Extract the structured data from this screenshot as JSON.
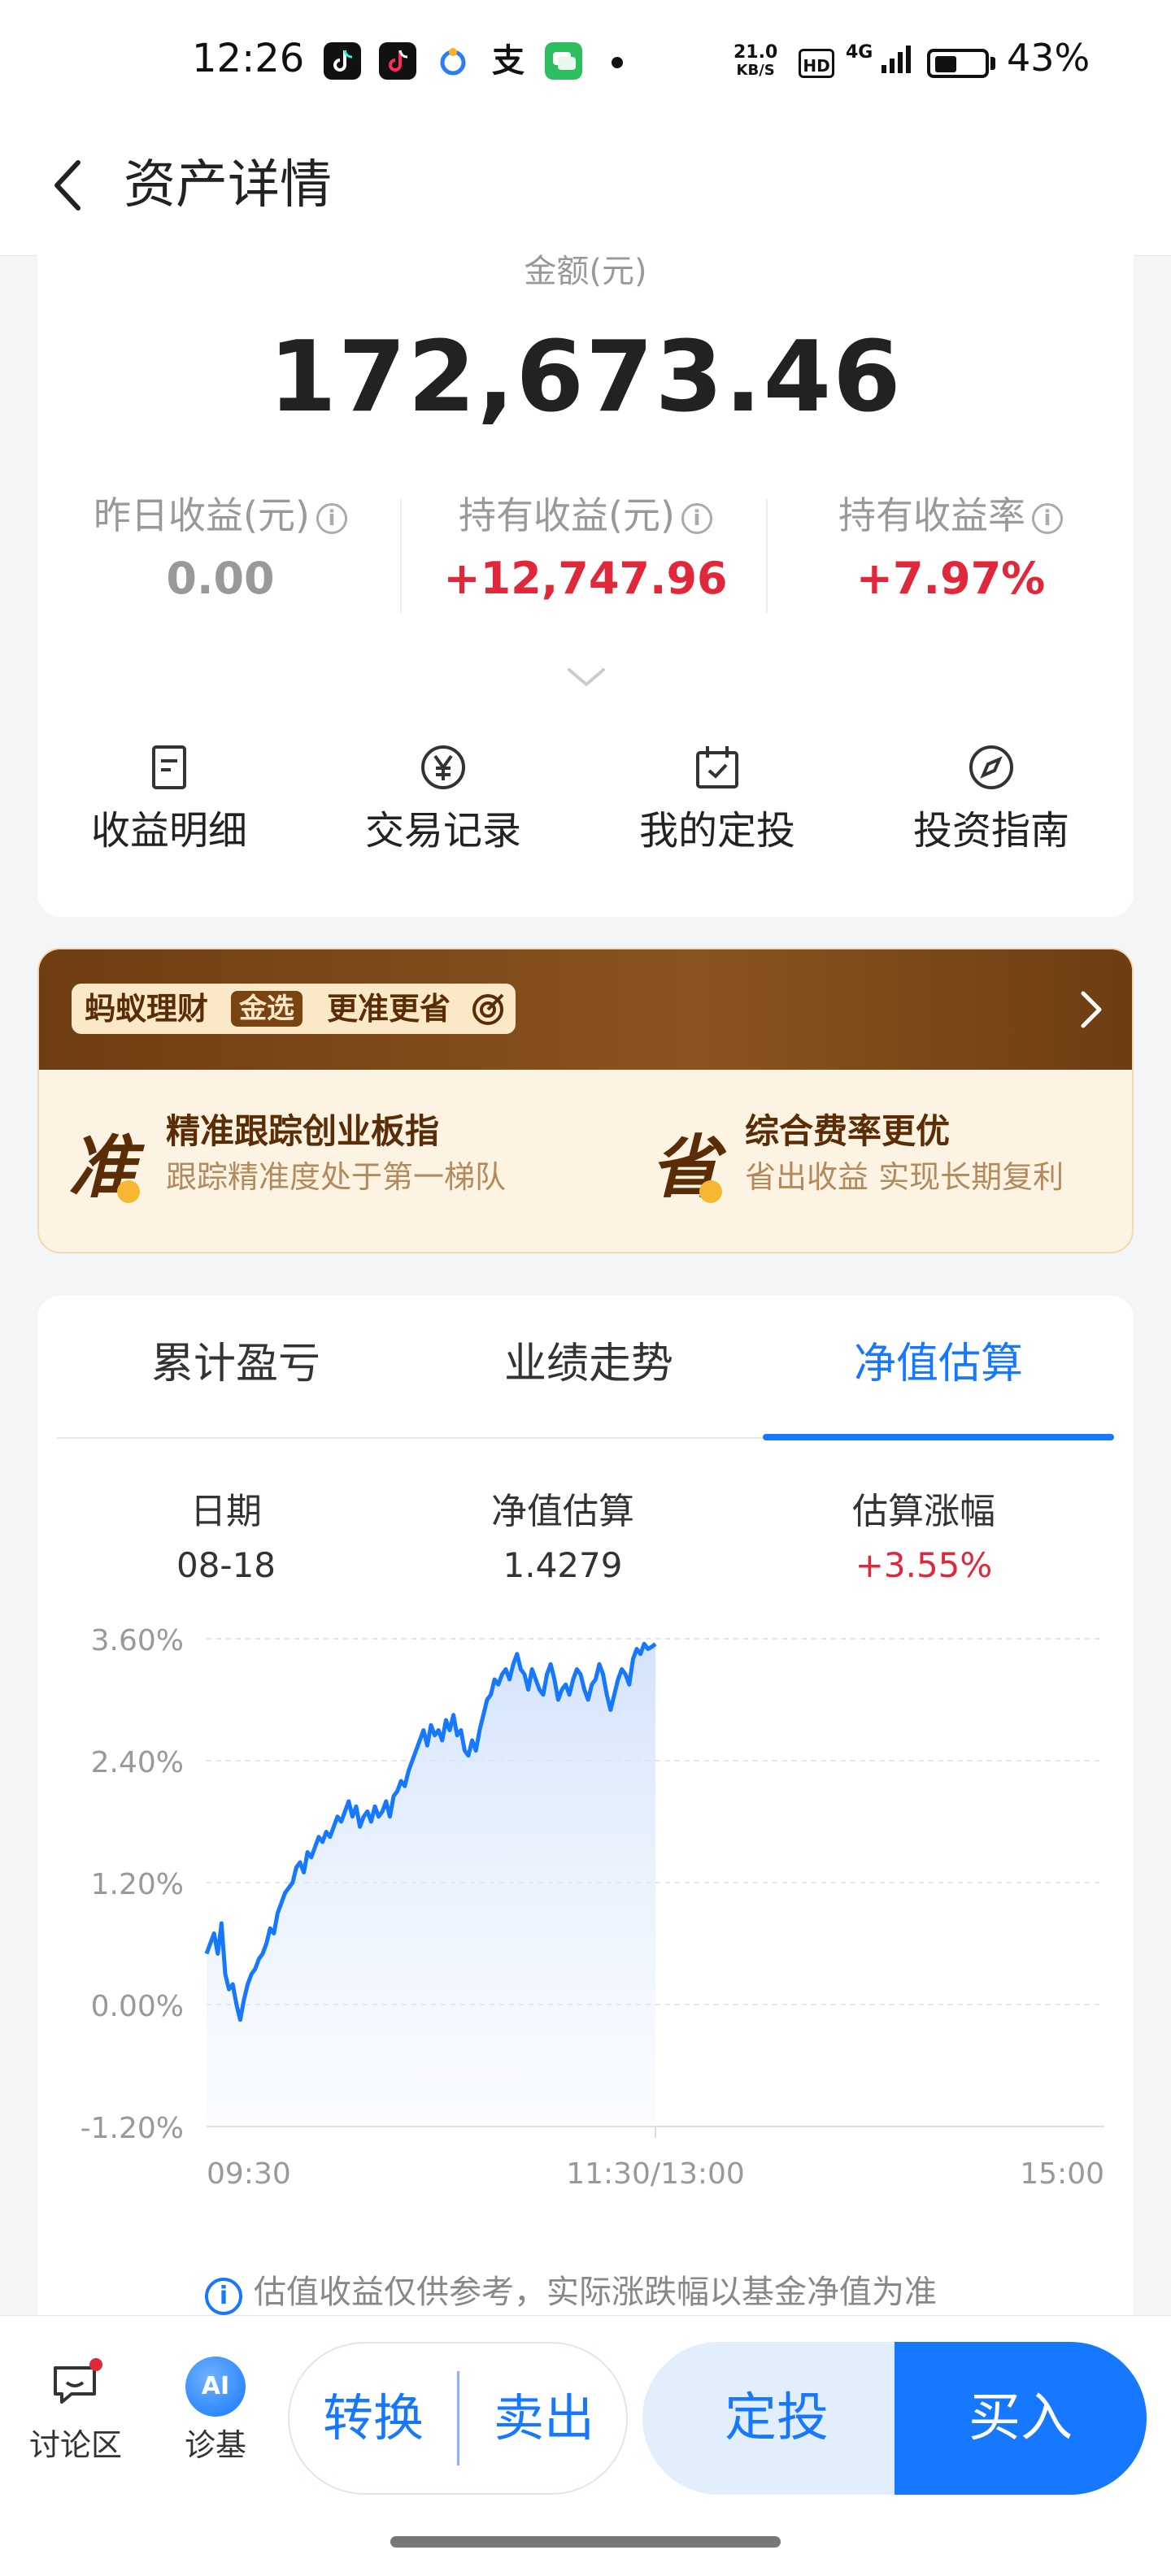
{
  "status_bar": {
    "time": "12:26",
    "net_speed": "21.0",
    "net_unit": "KB/S",
    "hd": "HD",
    "signal": "4G",
    "battery": "43%",
    "app_icons": [
      "tiktok-icon",
      "tiktok-lite-icon",
      "qq-browser-icon",
      "alipay-icon",
      "wechat-icon"
    ],
    "colors": {
      "tiktok": "#111111",
      "tiktok_lite": "#111111",
      "qq": "#ffb020",
      "alipay": "#111111",
      "wechat": "#2dbe60"
    }
  },
  "header": {
    "title": "资产详情",
    "back_icon": "chevron-left-icon"
  },
  "summary": {
    "amount_label": "金额(元)",
    "amount": "172,673.46",
    "stats": [
      {
        "label": "昨日收益(元)",
        "value": "0.00",
        "color": "#999999"
      },
      {
        "label": "持有收益(元)",
        "value": "+12,747.96",
        "color": "#e0283a"
      },
      {
        "label": "持有收益率",
        "value": "+7.97%",
        "color": "#e0283a"
      }
    ],
    "actions": [
      {
        "label": "收益明细",
        "icon": "document-icon"
      },
      {
        "label": "交易记录",
        "icon": "yuan-circle-icon"
      },
      {
        "label": "我的定投",
        "icon": "calendar-check-icon"
      },
      {
        "label": "投资指南",
        "icon": "compass-icon"
      }
    ]
  },
  "promo": {
    "brand": "蚂蚁理财",
    "tag": "金选",
    "slogan": "更准更省",
    "features": [
      {
        "icon_char": "准",
        "title": "精准跟踪创业板指",
        "subtitle": "跟踪精准度处于第一梯队"
      },
      {
        "icon_char": "省",
        "title": "综合费率更优",
        "subtitle": "省出收益 实现长期复利"
      }
    ]
  },
  "chart_section": {
    "tabs": [
      "累计盈亏",
      "业绩走势",
      "净值估算"
    ],
    "active_tab": 2,
    "header": [
      {
        "label": "日期",
        "value": "08-18",
        "color": "#333333"
      },
      {
        "label": "净值估算",
        "value": "1.4279",
        "color": "#333333"
      },
      {
        "label": "估算涨幅",
        "value": "+3.55%",
        "color": "#e0283a"
      }
    ],
    "footnote": "估值收益仅供参考，实际涨跌幅以基金净值为准",
    "accent": "#1677ff"
  },
  "chart_data": {
    "type": "area",
    "yticks": [
      "3.60%",
      "2.40%",
      "1.20%",
      "0.00%",
      "-1.20%"
    ],
    "ylim": [
      -1.2,
      3.6
    ],
    "xticks": [
      "09:30",
      "11:30/13:00",
      "15:00"
    ],
    "x_minutes_range": [
      0,
      240
    ],
    "grid": true,
    "series": [
      {
        "x": [
          0,
          1,
          2,
          3,
          4,
          5,
          6,
          7,
          8,
          9,
          10,
          11,
          12,
          13,
          14,
          15,
          16,
          17,
          18,
          19,
          20,
          21,
          22,
          23,
          24,
          25,
          26,
          27,
          28,
          29,
          30,
          31,
          32,
          33,
          34,
          35,
          36,
          37,
          38,
          39,
          40,
          41,
          42,
          43,
          44,
          45,
          46,
          47,
          48,
          49,
          50,
          51,
          52,
          53,
          54,
          55,
          56,
          57,
          58,
          59,
          60,
          61,
          62,
          63,
          64,
          65,
          66,
          67,
          68,
          69,
          70,
          71,
          72,
          73,
          74,
          75,
          76,
          77,
          78,
          79,
          80,
          81,
          82,
          83,
          84,
          85,
          86,
          87,
          88,
          89,
          90,
          91,
          92,
          93,
          94,
          95,
          96,
          97,
          98,
          99,
          100,
          101,
          102,
          103,
          104,
          105,
          106,
          107,
          108,
          109,
          110,
          111,
          112,
          113,
          114,
          115,
          116,
          117,
          118,
          119,
          120
        ],
        "values": [
          0.5,
          0.6,
          0.7,
          0.5,
          0.8,
          0.3,
          0.15,
          0.2,
          0.0,
          -0.15,
          0.05,
          0.2,
          0.3,
          0.35,
          0.45,
          0.5,
          0.6,
          0.75,
          0.7,
          0.9,
          1.0,
          1.1,
          1.15,
          1.2,
          1.35,
          1.4,
          1.3,
          1.5,
          1.45,
          1.55,
          1.65,
          1.6,
          1.7,
          1.65,
          1.75,
          1.85,
          1.8,
          1.9,
          2.0,
          1.85,
          1.95,
          1.75,
          1.85,
          1.9,
          1.8,
          1.95,
          1.85,
          1.9,
          2.0,
          1.85,
          2.05,
          2.1,
          2.2,
          2.15,
          2.3,
          2.4,
          2.5,
          2.6,
          2.7,
          2.55,
          2.75,
          2.65,
          2.7,
          2.6,
          2.8,
          2.7,
          2.85,
          2.65,
          2.7,
          2.5,
          2.45,
          2.6,
          2.5,
          2.7,
          2.85,
          3.0,
          3.05,
          3.2,
          3.15,
          3.25,
          3.3,
          3.2,
          3.35,
          3.45,
          3.3,
          3.25,
          3.1,
          3.3,
          3.2,
          3.1,
          3.05,
          3.25,
          3.35,
          3.2,
          3.0,
          3.1,
          3.15,
          3.05,
          3.2,
          3.3,
          3.25,
          3.1,
          3.0,
          3.15,
          3.2,
          3.35,
          3.25,
          3.05,
          2.9,
          3.05,
          3.2,
          3.3,
          3.25,
          3.15,
          3.4,
          3.5,
          3.45,
          3.55,
          3.5,
          3.52,
          3.55
        ]
      }
    ]
  },
  "bottom_bar": {
    "discuss_label": "讨论区",
    "diagnose_label": "诊基",
    "ai_label": "AI",
    "convert": "转换",
    "sell": "卖出",
    "auto_invest": "定投",
    "buy": "买入"
  }
}
